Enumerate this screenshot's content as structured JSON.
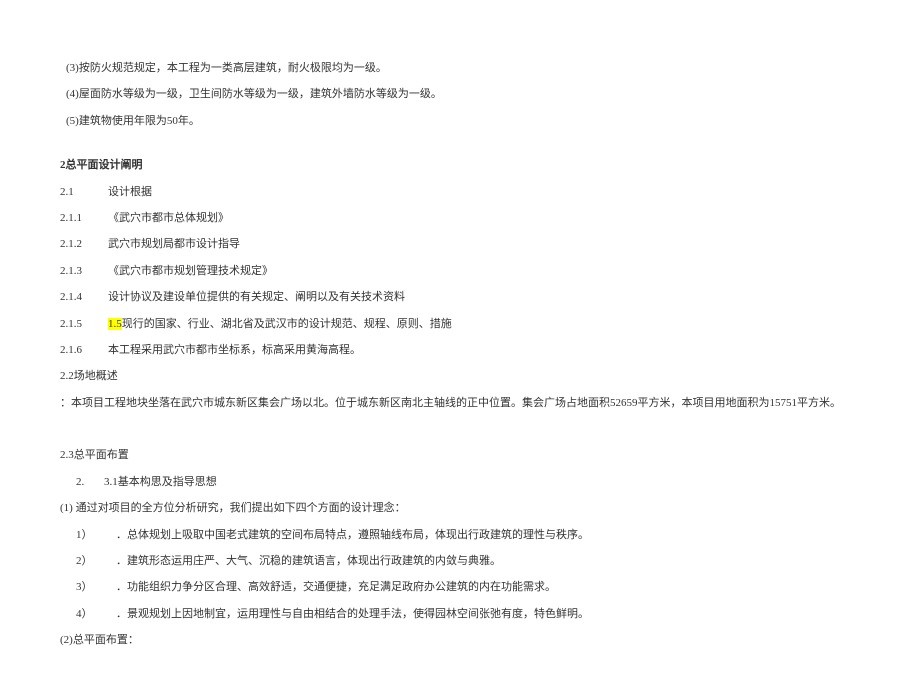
{
  "top": {
    "p3": "(3)按防火规范规定，本工程为一类高层建筑，耐火极限均为一级。",
    "p4": "(4)屋面防水等级为一级，卫生间防水等级为一级，建筑外墙防水等级为一级。",
    "p5": "(5)建筑物使用年限为50年。"
  },
  "sec2": {
    "title": "2总平面设计阐明",
    "s21": {
      "heading_num": "2.1",
      "heading": "设计根据",
      "items": {
        "i1_num": "2.1.1",
        "i1": "《武穴市都市总体规划》",
        "i2_num": "2.1.2",
        "i2": "武穴市规划局都市设计指导",
        "i3_num": "2.1.3",
        "i3": "《武穴市都市规划管理技术规定》",
        "i4_num": "2.1.4",
        "i4": "设计协议及建设单位提供的有关规定、阐明以及有关技术资料",
        "i5_num": "2.1.5",
        "i5_hl": "1.5",
        "i5_rest": "现行的国家、行业、湖北省及武汉市的设计规范、规程、原则、措施",
        "i6_num": "2.1.6",
        "i6": "本工程采用武穴市都市坐标系，标高采用黄海高程。"
      }
    },
    "s22": {
      "heading": "2.2场地概述",
      "content": "：本项目工程地块坐落在武穴市城东新区集会广场以北。位于城东新区南北主轴线的正中位置。集会广场占地面积52659平方米，本项目用地面积为15751平方米。"
    },
    "s23": {
      "heading": "2.3总平面布置",
      "sub_num": "2.",
      "sub": "3.1基本构思及指导思想",
      "p1": "(1) 通过对项目的全方位分析研究，我们提出如下四个方面的设计理念：",
      "d1_num": "1）",
      "d1": "．总体规划上吸取中国老式建筑的空间布局特点，遵照轴线布局，体现出行政建筑的理性与秩序。",
      "d2_num": "2）",
      "d2": "．建筑形态运用庄严、大气、沉稳的建筑语言，体现出行政建筑的内敛与典雅。",
      "d3_num": "3）",
      "d3": "．功能组织力争分区合理、高效舒适，交通便捷，充足满足政府办公建筑的内在功能需求。",
      "d4_num": "4）",
      "d4": "．景观规划上因地制宜，运用理性与自由相结合的处理手法，使得园林空间张弛有度，特色鲜明。",
      "p2": "(2)总平面布置："
    }
  }
}
